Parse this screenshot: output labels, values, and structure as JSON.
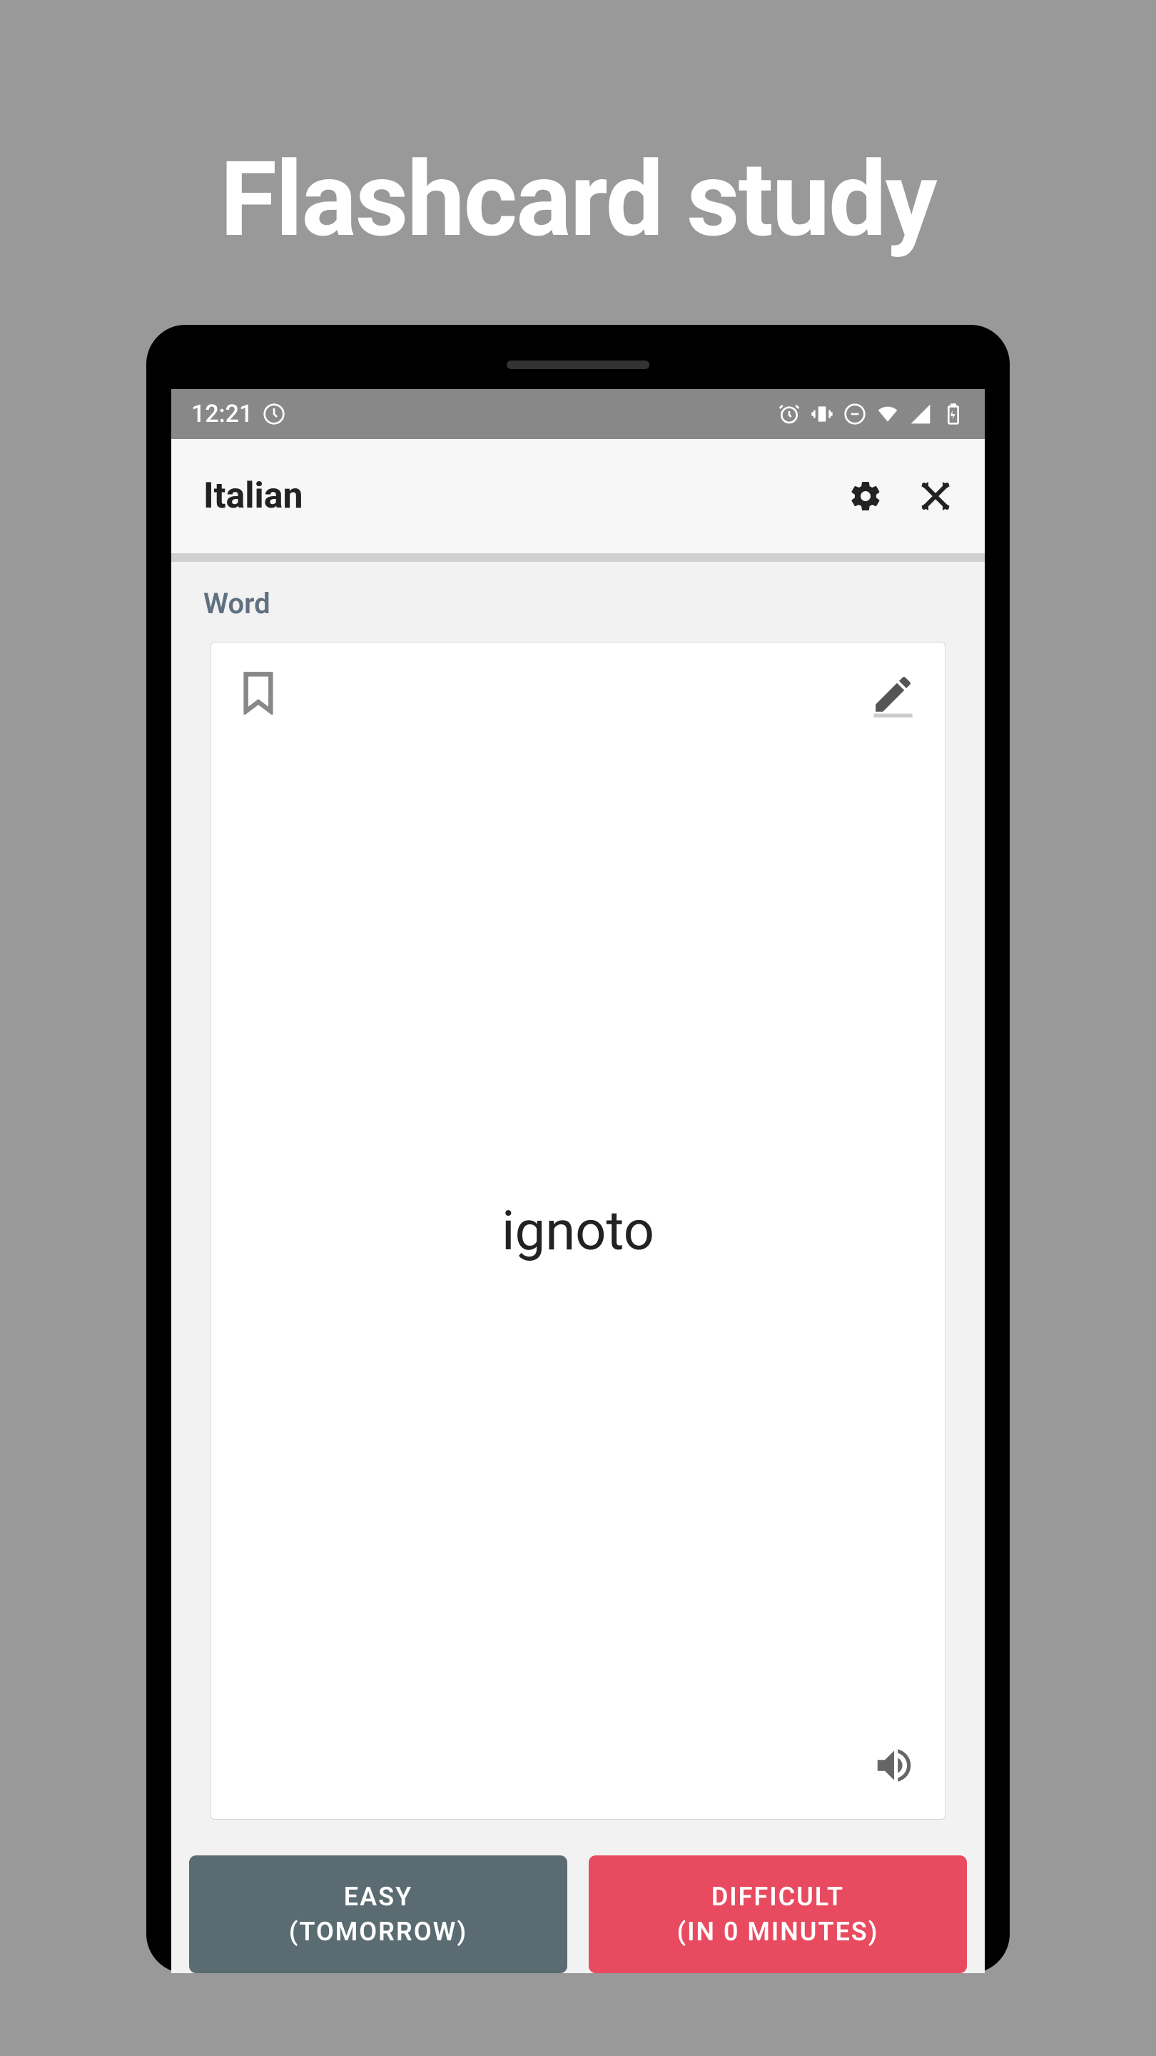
{
  "page": {
    "title": "Flashcard study"
  },
  "statusBar": {
    "time": "12:21"
  },
  "header": {
    "title": "Italian"
  },
  "section": {
    "label": "Word"
  },
  "card": {
    "word": "ignoto"
  },
  "buttons": {
    "easy": {
      "line1": "EASY",
      "line2": "(TOMORROW)"
    },
    "difficult": {
      "line1": "DIFFICULT",
      "line2": "(IN 0 MINUTES)"
    }
  }
}
